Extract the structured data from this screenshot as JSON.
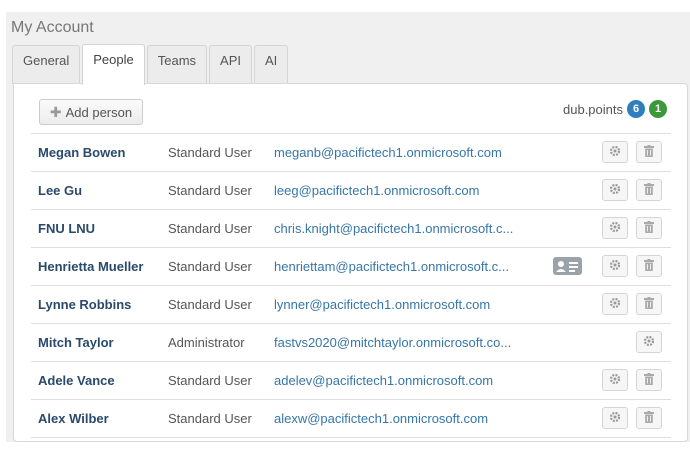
{
  "page": {
    "title": "My Account"
  },
  "tabs": [
    {
      "label": "General",
      "active": false
    },
    {
      "label": "People",
      "active": true
    },
    {
      "label": "Teams",
      "active": false
    },
    {
      "label": "API",
      "active": false
    },
    {
      "label": "AI",
      "active": false
    }
  ],
  "toolbar": {
    "add_person_label": "Add person",
    "points_label": "dub.points",
    "badge_blue": "6",
    "badge_green": "1"
  },
  "colors": {
    "badge_blue": "#2f7fbf",
    "badge_green": "#3a9a3a",
    "name": "#2a4a6b",
    "email": "#3676a8"
  },
  "people": [
    {
      "name": "Megan Bowen",
      "role": "Standard User",
      "email": "meganb@pacifictech1.onmicrosoft.com",
      "card": false,
      "trash": true
    },
    {
      "name": "Lee Gu",
      "role": "Standard User",
      "email": "leeg@pacifictech1.onmicrosoft.com",
      "card": false,
      "trash": true
    },
    {
      "name": "FNU LNU",
      "role": "Standard User",
      "email": "chris.knight@pacifictech1.onmicrosoft.c...",
      "card": false,
      "trash": true
    },
    {
      "name": "Henrietta Mueller",
      "role": "Standard User",
      "email": "henriettam@pacifictech1.onmicrosoft.c...",
      "card": true,
      "trash": true
    },
    {
      "name": "Lynne Robbins",
      "role": "Standard User",
      "email": "lynner@pacifictech1.onmicrosoft.com",
      "card": false,
      "trash": true
    },
    {
      "name": "Mitch Taylor",
      "role": "Administrator",
      "email": "fastvs2020@mitchtaylor.onmicrosoft.co...",
      "card": false,
      "trash": false
    },
    {
      "name": "Adele Vance",
      "role": "Standard User",
      "email": "adelev@pacifictech1.onmicrosoft.com",
      "card": false,
      "trash": true
    },
    {
      "name": "Alex Wilber",
      "role": "Standard User",
      "email": "alexw@pacifictech1.onmicrosoft.com",
      "card": false,
      "trash": true
    }
  ]
}
